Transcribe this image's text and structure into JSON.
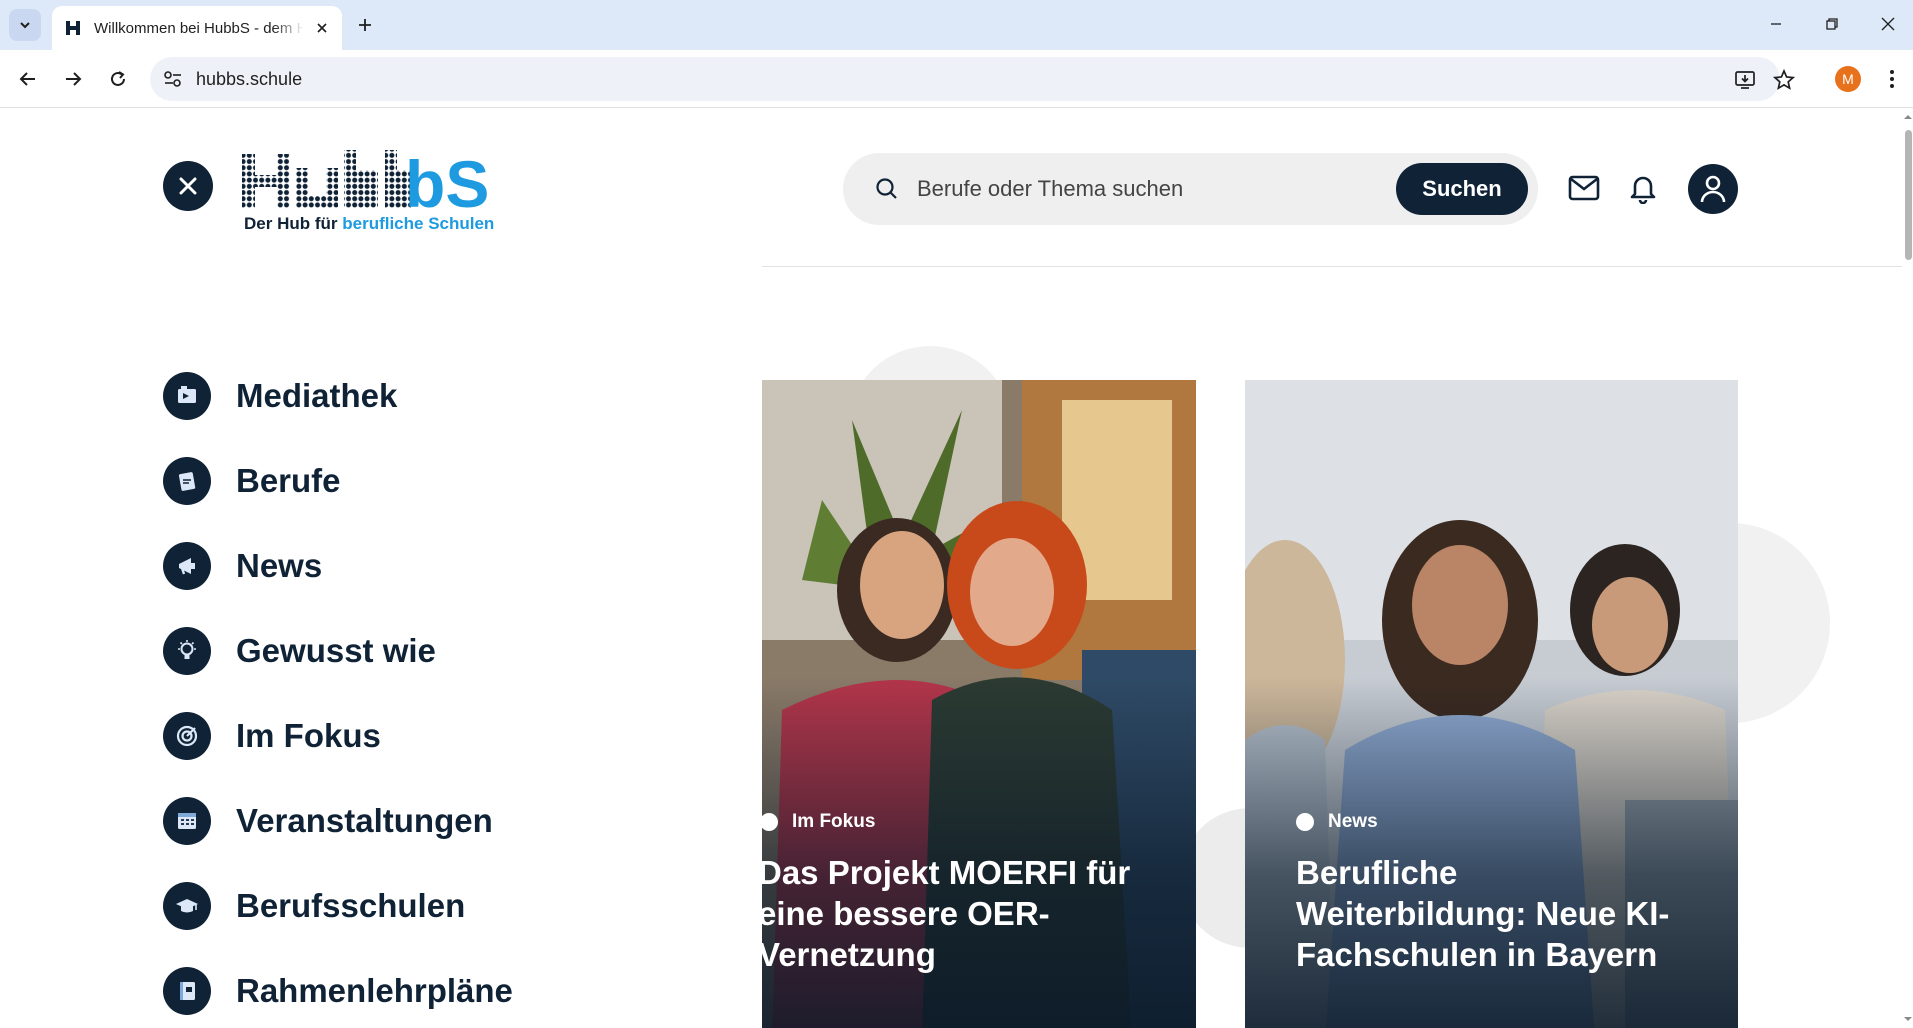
{
  "browser": {
    "tab_title": "Willkommen bei HubbS - dem Hub für berufliche Schulen",
    "url": "hubbs.schule",
    "profile_initial": "M"
  },
  "header": {
    "search_placeholder": "Berufe oder Thema suchen",
    "search_button": "Suchen"
  },
  "logo": {
    "name": "HubbS",
    "tagline_start": "Der Hub für ",
    "tagline_accent": "berufliche Schulen"
  },
  "menu": {
    "items": [
      {
        "label": "Mediathek",
        "icon": "media-icon"
      },
      {
        "label": "Berufe",
        "icon": "profession-icon"
      },
      {
        "label": "News",
        "icon": "megaphone-icon"
      },
      {
        "label": "Gewusst wie",
        "icon": "lightbulb-icon"
      },
      {
        "label": "Im Fokus",
        "icon": "target-icon"
      },
      {
        "label": "Veranstaltungen",
        "icon": "calendar-icon"
      },
      {
        "label": "Berufsschulen",
        "icon": "graduation-cap-icon"
      },
      {
        "label": "Rahmenlehrpläne",
        "icon": "notebook-icon"
      }
    ]
  },
  "cards": [
    {
      "tag": "Im Fokus",
      "title": "Das Projekt MOERFI für eine bessere OER-Vernetzung",
      "title_lines": [
        "Das Projekt MOERFI für",
        "eine bessere OER-",
        "Vernetzung"
      ]
    },
    {
      "tag": "News",
      "title": "Berufliche Weiterbildung: Neue KI-Fachschulen in Bayern",
      "title_lines": [
        "Berufliche",
        "Weiterbildung: Neue KI-",
        "Fachschulen in Bayern"
      ]
    }
  ],
  "colors": {
    "navy": "#102236",
    "accent_blue": "#1e9ae0",
    "tab_strip": "#dde8f8"
  }
}
